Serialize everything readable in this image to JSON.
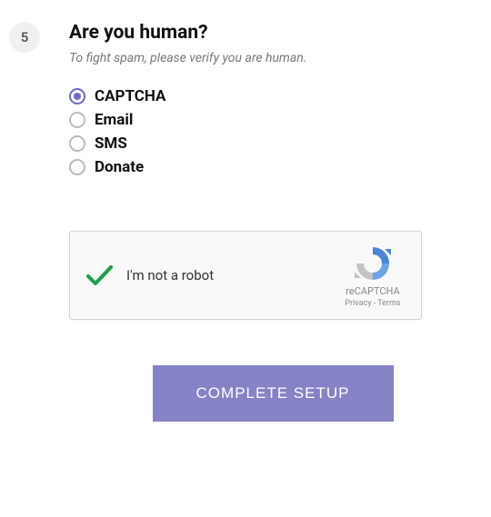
{
  "step": {
    "number": "5",
    "title": "Are you human?",
    "subtitle": "To fight spam, please verify you are human."
  },
  "options": [
    {
      "label": "CAPTCHA",
      "selected": true
    },
    {
      "label": "Email",
      "selected": false
    },
    {
      "label": "SMS",
      "selected": false
    },
    {
      "label": "Donate",
      "selected": false
    }
  ],
  "recaptcha": {
    "text": "I'm not a robot",
    "brand": "reCAPTCHA",
    "privacy": "Privacy",
    "terms": "Terms"
  },
  "button": {
    "label": "COMPLETE SETUP"
  }
}
